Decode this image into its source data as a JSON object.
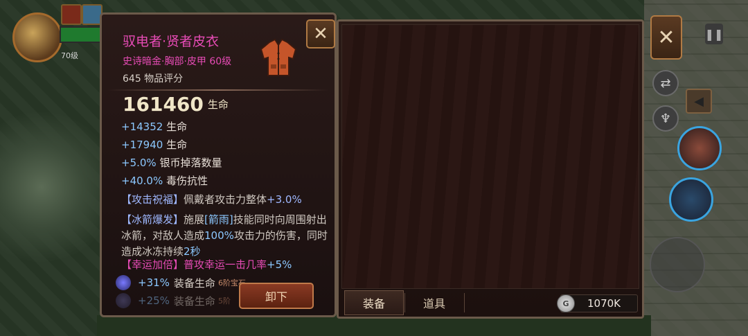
{
  "item": {
    "name": "驭电者·贤者皮衣",
    "type": "史诗暗金·胸部·皮甲 60级",
    "score": "645 物品评分",
    "main_stat": {
      "value": "161460",
      "label": "生命"
    },
    "stats": [
      {
        "value": "+14352",
        "label": "生命"
      },
      {
        "value": "+17940",
        "label": "生命"
      },
      {
        "value": "+5.0%",
        "label": "银币掉落数量"
      },
      {
        "value": "+40.0%",
        "label": "毒伤抗性"
      }
    ],
    "blessing": {
      "head": "【攻击祝福】",
      "text": "佩戴者攻击力整体",
      "value": "+3.0%"
    },
    "skill": {
      "head": "【冰箭爆发】",
      "p1": "施展",
      "skill_name": "[箭雨]",
      "p2": "技能同时向周围射出冰箭，对敌人造成",
      "pct": "100%",
      "p3": "攻击力的伤害，同时造成冰冻持续",
      "sec": "2秒"
    },
    "luck": {
      "head": "【幸运加倍】",
      "text": "普攻幸运一击几率",
      "value": "+5%"
    },
    "gems": [
      {
        "value": "+31%",
        "label": "装备生命",
        "sub": "6阶宝石"
      },
      {
        "value": "+25%",
        "label": "装备生命",
        "sub": "5阶"
      }
    ],
    "unequip_label": "卸下"
  },
  "inventory": {
    "tabs": [
      {
        "label": "装备",
        "active": true
      },
      {
        "label": "道具",
        "active": false
      }
    ],
    "currency": {
      "icon": "silver-coin-icon",
      "symbol": "G",
      "amount": "1070K"
    }
  },
  "hud": {
    "level_num": "70级",
    "close_symbol": "✕"
  },
  "colors": {
    "epic": "#e64bb5",
    "stat_blue": "#8cc8ff",
    "panel_bg": "#1c100e"
  }
}
